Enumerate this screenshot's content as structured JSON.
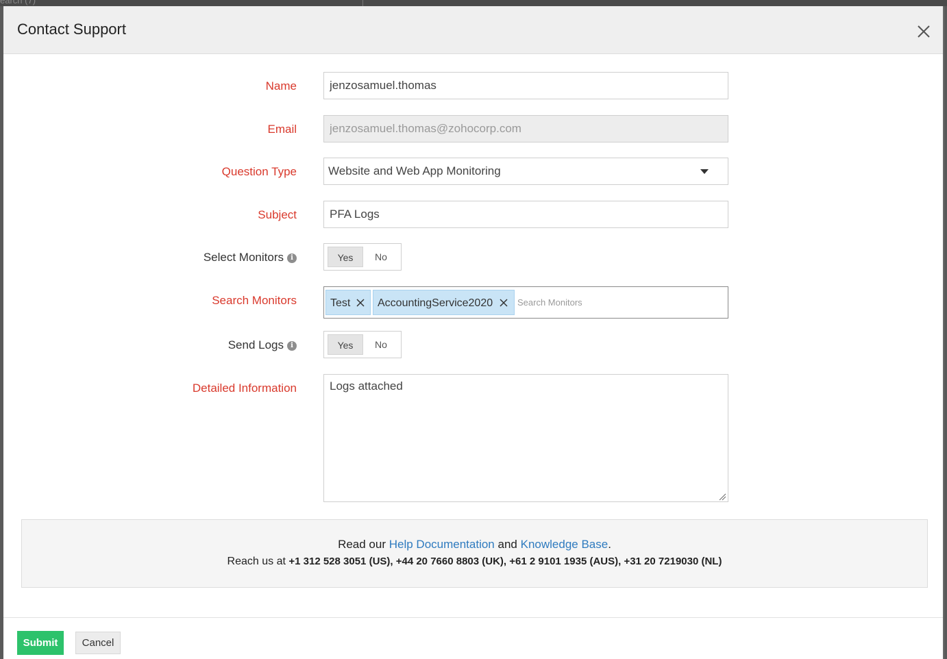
{
  "backdrop": {
    "partial_text": "earch (7)"
  },
  "modal": {
    "title": "Contact Support"
  },
  "form": {
    "name": {
      "label": "Name",
      "value": "jenzosamuel.thomas"
    },
    "email": {
      "label": "Email",
      "value": "jenzosamuel.thomas@zohocorp.com"
    },
    "question_type": {
      "label": "Question Type",
      "value": "Website and Web App Monitoring"
    },
    "subject": {
      "label": "Subject",
      "value": "PFA Logs"
    },
    "select_monitors": {
      "label": "Select Monitors",
      "yes": "Yes",
      "no": "No",
      "selected": "Yes"
    },
    "search_monitors": {
      "label": "Search Monitors",
      "tags": [
        "Test",
        "AccountingService2020"
      ],
      "placeholder": "Search Monitors"
    },
    "send_logs": {
      "label": "Send Logs",
      "yes": "Yes",
      "no": "No",
      "selected": "Yes"
    },
    "detailed_information": {
      "label": "Detailed Information",
      "value": "Logs attached"
    }
  },
  "info": {
    "read_our": "Read our",
    "help_documentation": "Help Documentation",
    "and": "and",
    "knowledge_base": "Knowledge Base",
    "period": ".",
    "reach_us": "Reach us at",
    "phones": "+1 312 528 3051 (US), +44 20 7660 8803 (UK), +61 2 9101 1935 (AUS), +31 20 7219030 (NL)"
  },
  "footer": {
    "submit_label": "Submit",
    "cancel_label": "Cancel"
  },
  "colors": {
    "required_label": "#d9392c",
    "link": "#2f7bbf",
    "submit_bg": "#2dc26b",
    "tag_bg": "#c9e4f6"
  }
}
